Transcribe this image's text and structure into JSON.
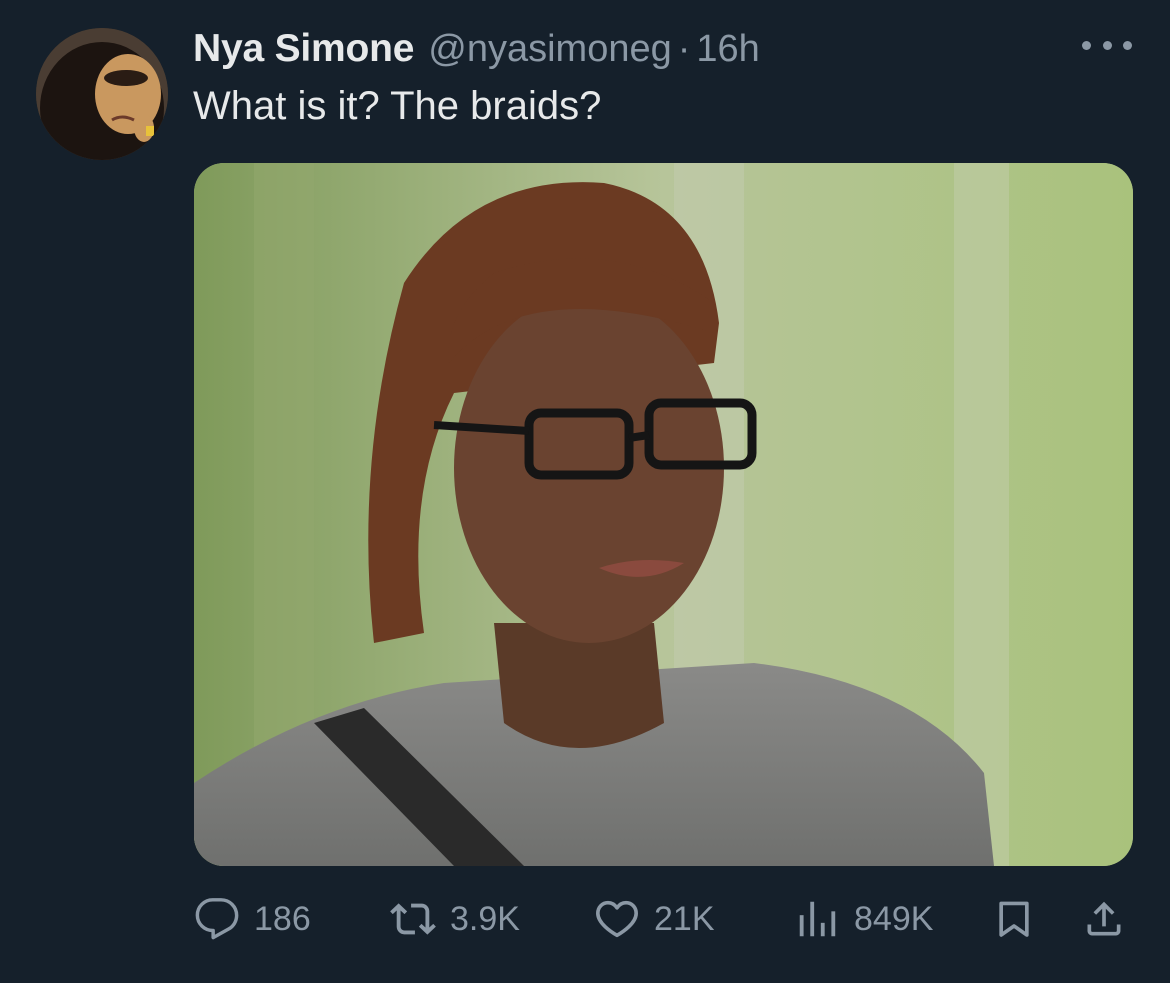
{
  "tweet": {
    "author": {
      "display_name": "Nya Simone",
      "handle": "@nyasimoneg",
      "separator": "·",
      "time": "16h"
    },
    "text": "What is it? The braids?",
    "media": {
      "type": "photo"
    },
    "metrics": {
      "replies": "186",
      "retweets": "3.9K",
      "likes": "21K",
      "views": "849K"
    },
    "icons": {
      "more": "more-icon",
      "reply": "reply-icon",
      "retweet": "retweet-icon",
      "like": "heart-icon",
      "views": "analytics-icon",
      "bookmark": "bookmark-icon",
      "share": "share-icon"
    }
  },
  "colors": {
    "background": "#15202b",
    "primary_text": "#e7e9ea",
    "secondary_text": "#8b98a5"
  }
}
